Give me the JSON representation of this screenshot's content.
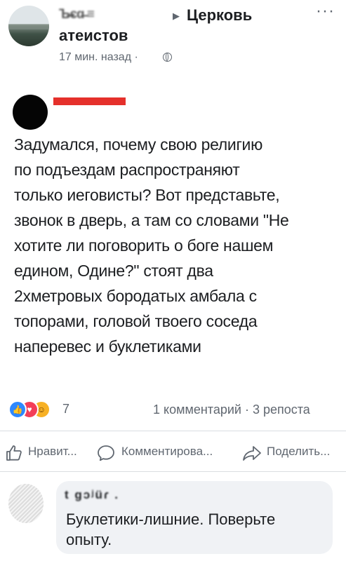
{
  "post": {
    "author_name": "Ъ̶єɑ̶ ≡",
    "group_line1": "Церковь",
    "group_line2": "атеистов",
    "timestamp": "17 мин. назад ·",
    "privacy_icon": "globe-icon",
    "menu_icon": "more-icon",
    "more_symbol": "···"
  },
  "quoted": {
    "avatar_color": "#050505",
    "name_bar_color": "#e5302b",
    "text": "Задумался, почему свою религию\nпо подъездам распространяют\nтолько иеговисты? Вот представьте,\nзвонок в дверь, а там со словами \"Не\nхотите ли поговорить о боге нашем\nедином, Одине?\" стоят два\n2хметровых бородатых амбала с\nтопорами, головой твоего соседа\nнаперевес и буклетиками"
  },
  "reactions": {
    "icons": [
      "like-icon",
      "love-icon",
      "haha-icon"
    ],
    "count": "7",
    "comments_shares": "1 комментарий · 3 репоста"
  },
  "actions": {
    "like_label": "Нравит...",
    "comment_label": "Комментирова...",
    "share_label": "Поделить..."
  },
  "comment": {
    "author": "t  gɔʲüɾ .",
    "text": "Буклетики-лишние. Поверьте\nопыту."
  },
  "colors": {
    "accent_blue": "#2d88ff",
    "text": "#1c1e21",
    "secondary_text": "#606770",
    "bubble": "#f0f2f5"
  }
}
